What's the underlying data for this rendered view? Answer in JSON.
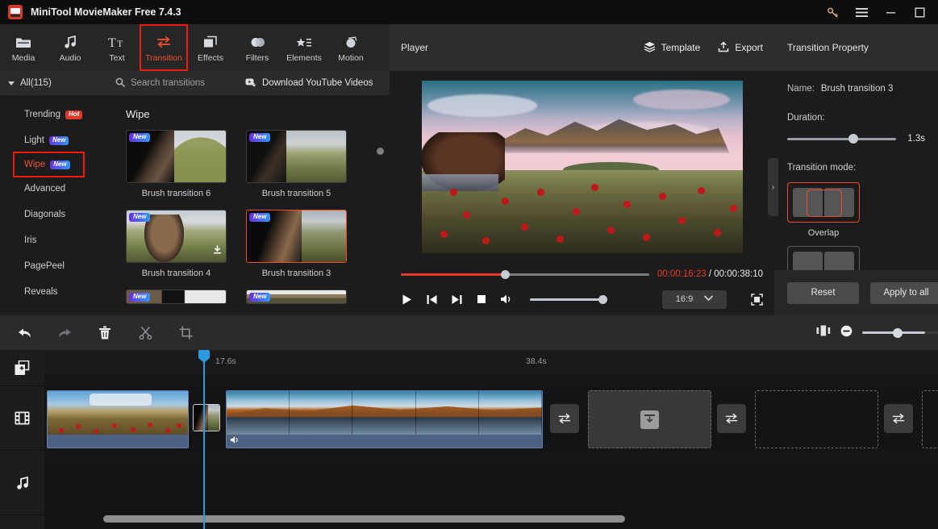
{
  "titlebar": {
    "app_title": "MiniTool MovieMaker Free 7.4.3",
    "icons": {
      "logo": "app-logo",
      "key": "key-icon",
      "menu": "hamburger-menu-icon",
      "minimize": "minimize-icon",
      "maximize": "maximize-icon"
    }
  },
  "ribbon": {
    "items": [
      {
        "label": "Media",
        "icon": "folder-icon"
      },
      {
        "label": "Audio",
        "icon": "music-note-icon"
      },
      {
        "label": "Text",
        "icon": "text-icon"
      },
      {
        "label": "Transition",
        "icon": "transition-arrows-icon"
      },
      {
        "label": "Effects",
        "icon": "layers-icon"
      },
      {
        "label": "Filters",
        "icon": "circles-icon"
      },
      {
        "label": "Elements",
        "icon": "star-list-icon"
      },
      {
        "label": "Motion",
        "icon": "motion-icon"
      }
    ],
    "active_index": 3
  },
  "sidebar": {
    "all_label": "All(115)",
    "items": [
      {
        "label": "Trending",
        "badge": "Hot"
      },
      {
        "label": "Light",
        "badge": "New"
      },
      {
        "label": "Wipe",
        "badge": "New"
      },
      {
        "label": "Advanced",
        "badge": ""
      },
      {
        "label": "Diagonals",
        "badge": ""
      },
      {
        "label": "Iris",
        "badge": ""
      },
      {
        "label": "PagePeel",
        "badge": ""
      },
      {
        "label": "Reveals",
        "badge": ""
      }
    ],
    "selected_index": 2
  },
  "browser": {
    "search_placeholder": "Search transitions",
    "search_value": "",
    "download_label": "Download YouTube Videos",
    "group_title": "Wipe",
    "tiles": [
      {
        "label": "Brush transition 6",
        "badge": "New",
        "downloadable": false,
        "selected": false,
        "art": "couple1"
      },
      {
        "label": "Brush transition 5",
        "badge": "New",
        "downloadable": false,
        "selected": false,
        "art": "couple2"
      },
      {
        "label": "Brush transition 4",
        "badge": "New",
        "downloadable": true,
        "selected": false,
        "art": "couple3"
      },
      {
        "label": "Brush transition 3",
        "badge": "New",
        "downloadable": false,
        "selected": true,
        "art": "couple4"
      }
    ],
    "partial_tiles": [
      {
        "badge": "New",
        "art": "row3a"
      },
      {
        "badge": "New",
        "art": "row3b"
      }
    ]
  },
  "player": {
    "title": "Player",
    "template_label": "Template",
    "export_label": "Export",
    "current_time": "00:00:16:23",
    "separator": "/",
    "total_time": "00:00:38:10",
    "progress_percent": 42,
    "volume_percent": 100,
    "aspect_ratio": "16:9",
    "icons": {
      "template": "layers-icon",
      "export": "upload-icon",
      "play": "play-icon",
      "prev_frame": "previous-frame-icon",
      "next_frame": "next-frame-icon",
      "stop": "stop-icon",
      "volume": "volume-icon",
      "ratio_chevron": "chevron-down-icon",
      "fullscreen": "fullscreen-icon"
    }
  },
  "property": {
    "panel_title": "Transition Property",
    "name_label": "Name:",
    "name_value": "Brush transition 3",
    "duration_label": "Duration:",
    "duration_value": "1.3s",
    "mode_label": "Transition mode:",
    "mode_selected": "Overlap",
    "reset_label": "Reset",
    "apply_all_label": "Apply to all",
    "collapse_icon": "chevron-right-icon"
  },
  "timeline": {
    "tools": [
      {
        "name": "undo-button",
        "icon": "undo-icon"
      },
      {
        "name": "redo-button",
        "icon": "redo-icon"
      },
      {
        "name": "delete-button",
        "icon": "trash-icon"
      },
      {
        "name": "split-button",
        "icon": "scissors-icon"
      },
      {
        "name": "crop-button",
        "icon": "crop-icon"
      }
    ],
    "zoom": {
      "fit_icon": "fit-timeline-icon",
      "minus_icon": "zoom-out-icon",
      "value_percent": 49
    },
    "track_heads": [
      {
        "name": "add-media-track-button",
        "icon": "add-media-icon"
      },
      {
        "name": "video-track-header",
        "icon": "film-strip-icon"
      },
      {
        "name": "audio-track-header",
        "icon": "music-note-icon"
      }
    ],
    "ruler_marks": [
      "17.6s",
      "38.4s"
    ],
    "playhead_label": "17.6s",
    "transition_icon": "transition-arrows-icon",
    "placeholder_icon": "import-media-icon"
  },
  "colors": {
    "accent_red": "#ef5130",
    "highlight_red": "#f21c0d",
    "badge_new": "#2f9bf5",
    "badge_hot": "#e2382b",
    "playhead_blue": "#2b9ae1",
    "clip_audio_blue": "#4d6283"
  }
}
